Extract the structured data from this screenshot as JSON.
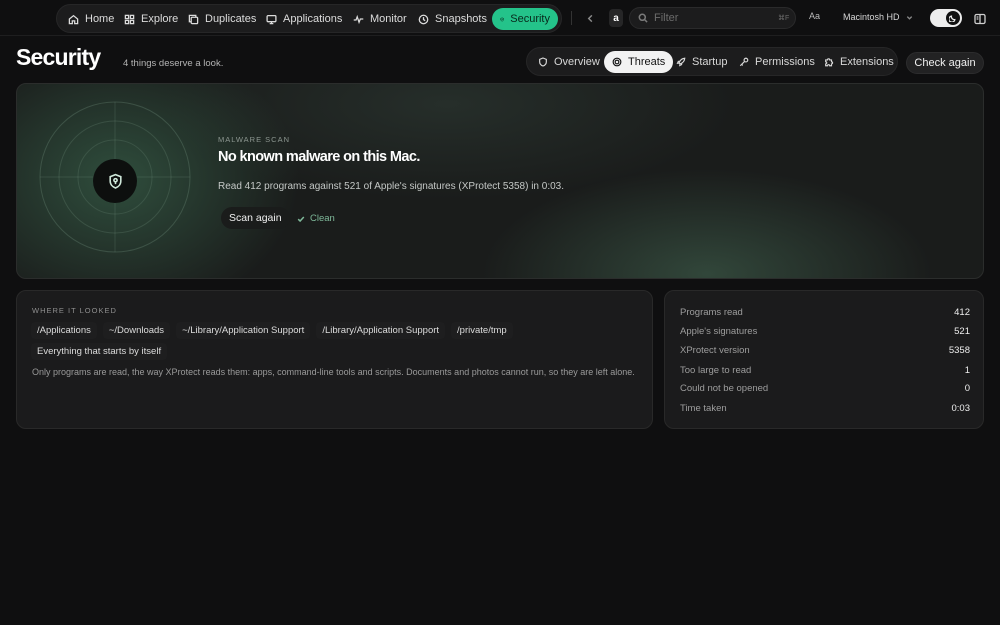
{
  "nav": {
    "items": [
      {
        "label": "Home",
        "icon": "home-icon"
      },
      {
        "label": "Explore",
        "icon": "grid-icon"
      },
      {
        "label": "Duplicates",
        "icon": "copy-icon"
      },
      {
        "label": "Applications",
        "icon": "monitor-icon"
      },
      {
        "label": "Monitor",
        "icon": "pulse-icon"
      },
      {
        "label": "Snapshots",
        "icon": "clock-icon"
      },
      {
        "label": "Security",
        "icon": "shield-icon",
        "active": true
      }
    ],
    "accent_color": "#24c38a"
  },
  "toolbar": {
    "letter": "a",
    "search_placeholder": "Filter",
    "search_shortcut": "⌘F",
    "font_button": "Aa",
    "disk": "Macintosh HD"
  },
  "page": {
    "title": "Security",
    "subtitle": "4 things deserve a look.",
    "tabs": [
      {
        "label": "Overview",
        "icon": "shield-icon"
      },
      {
        "label": "Threats",
        "icon": "target-icon",
        "active": true
      },
      {
        "label": "Startup",
        "icon": "rocket-icon"
      },
      {
        "label": "Permissions",
        "icon": "key-icon"
      },
      {
        "label": "Extensions",
        "icon": "puzzle-icon"
      }
    ],
    "check_again": "Check again"
  },
  "hero": {
    "eyebrow": "MALWARE SCAN",
    "title": "No known malware on this Mac.",
    "description": "Read 412 programs against 521 of Apple's signatures (XProtect 5358) in 0:03.",
    "scan_again": "Scan again",
    "status": "Clean",
    "status_color": "#7fb99a"
  },
  "looked": {
    "label": "WHERE IT LOOKED",
    "paths": [
      "/Applications",
      "~/Downloads",
      "~/Library/Application Support",
      "/Library/Application Support",
      "/private/tmp",
      "Everything that starts by itself"
    ],
    "note": "Only programs are read, the way XProtect reads them: apps, command-line tools and scripts. Documents and photos cannot run, so they are left alone."
  },
  "stats": [
    {
      "label": "Programs read",
      "value": "412"
    },
    {
      "label": "Apple's signatures",
      "value": "521"
    },
    {
      "label": "XProtect version",
      "value": "5358"
    },
    {
      "label": "Too large to read",
      "value": "1"
    },
    {
      "label": "Could not be opened",
      "value": "0"
    },
    {
      "label": "Time taken",
      "value": "0:03"
    }
  ]
}
